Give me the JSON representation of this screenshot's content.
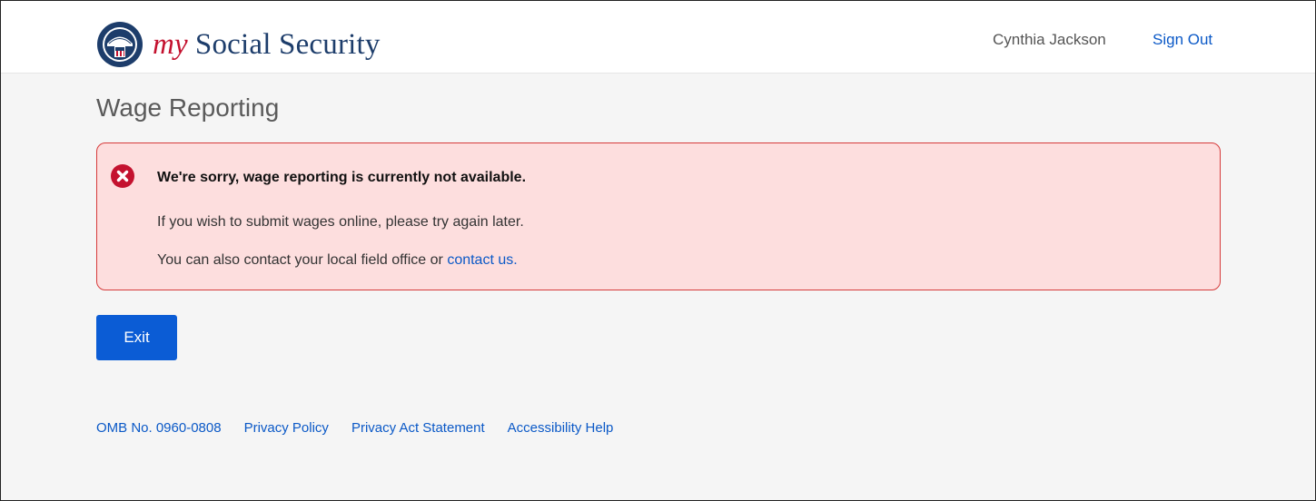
{
  "header": {
    "logo_my": "my",
    "logo_rest": "Social Security",
    "user_name": "Cynthia Jackson",
    "sign_out_label": "Sign Out"
  },
  "page": {
    "title": "Wage Reporting"
  },
  "alert": {
    "icon": "error-x-circle-icon",
    "heading": "We're sorry, wage reporting is currently not available.",
    "line1": "If you wish to submit wages online, please try again later.",
    "line2_prefix": "You can also contact your local field office or ",
    "line2_link": "contact us."
  },
  "actions": {
    "exit_label": "Exit"
  },
  "footer": {
    "links": [
      "OMB No. 0960-0808",
      "Privacy Policy",
      "Privacy Act Statement",
      "Accessibility Help"
    ]
  },
  "colors": {
    "brand_navy": "#1d3d6b",
    "brand_red": "#c4122f",
    "link_blue": "#0b59c7",
    "button_blue": "#0b5cd5",
    "alert_bg": "#fddede",
    "alert_border": "#d63b3b",
    "page_bg": "#f5f5f5"
  }
}
